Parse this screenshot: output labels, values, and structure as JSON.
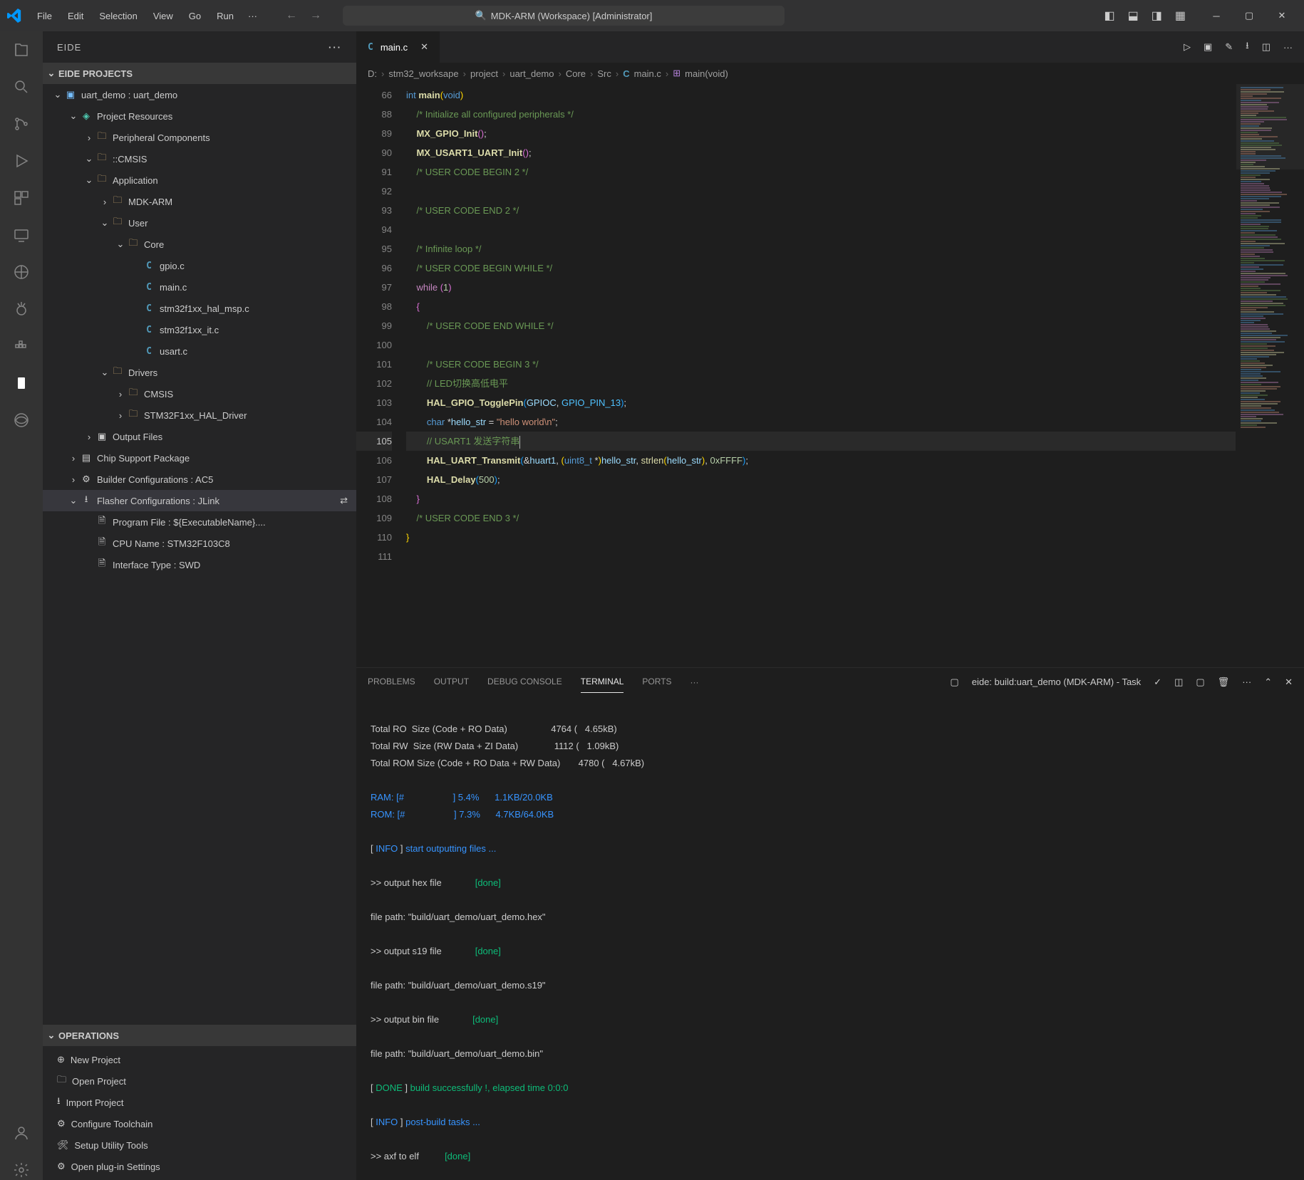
{
  "titlebar": {
    "menus": [
      "File",
      "Edit",
      "Selection",
      "View",
      "Go",
      "Run"
    ],
    "search_text": "MDK-ARM (Workspace) [Administrator]"
  },
  "sidebar": {
    "title": "EIDE",
    "section1": "EIDE PROJECTS",
    "tree": [
      {
        "depth": 0,
        "chev": "v",
        "icon": "proj",
        "label": "uart_demo : uart_demo"
      },
      {
        "depth": 1,
        "chev": "v",
        "icon": "res",
        "label": "Project Resources"
      },
      {
        "depth": 2,
        "chev": ">",
        "icon": "folder",
        "label": "Peripheral Components"
      },
      {
        "depth": 2,
        "chev": "v",
        "icon": "folder",
        "label": "::CMSIS"
      },
      {
        "depth": 2,
        "chev": "v",
        "icon": "folder",
        "label": "Application"
      },
      {
        "depth": 3,
        "chev": ">",
        "icon": "folder",
        "label": "MDK-ARM"
      },
      {
        "depth": 3,
        "chev": "v",
        "icon": "folder",
        "label": "User"
      },
      {
        "depth": 4,
        "chev": "v",
        "icon": "folder",
        "label": "Core"
      },
      {
        "depth": 5,
        "chev": "",
        "icon": "c",
        "label": "gpio.c"
      },
      {
        "depth": 5,
        "chev": "",
        "icon": "c",
        "label": "main.c"
      },
      {
        "depth": 5,
        "chev": "",
        "icon": "c",
        "label": "stm32f1xx_hal_msp.c"
      },
      {
        "depth": 5,
        "chev": "",
        "icon": "c",
        "label": "stm32f1xx_it.c"
      },
      {
        "depth": 5,
        "chev": "",
        "icon": "c",
        "label": "usart.c"
      },
      {
        "depth": 3,
        "chev": "v",
        "icon": "folder",
        "label": "Drivers"
      },
      {
        "depth": 4,
        "chev": ">",
        "icon": "folder",
        "label": "CMSIS"
      },
      {
        "depth": 4,
        "chev": ">",
        "icon": "folder",
        "label": "STM32F1xx_HAL_Driver"
      },
      {
        "depth": 2,
        "chev": ">",
        "icon": "out",
        "label": "Output Files"
      },
      {
        "depth": 1,
        "chev": ">",
        "icon": "chip",
        "label": "Chip Support Package"
      },
      {
        "depth": 1,
        "chev": ">",
        "icon": "build",
        "label": "Builder Configurations : AC5"
      },
      {
        "depth": 1,
        "chev": "v",
        "icon": "flash",
        "label": "Flasher Configurations : JLink",
        "selected": true,
        "trail": true
      },
      {
        "depth": 2,
        "chev": "",
        "icon": "file",
        "label": "Program File : ${ExecutableName}...."
      },
      {
        "depth": 2,
        "chev": "",
        "icon": "file",
        "label": "CPU Name : STM32F103C8"
      },
      {
        "depth": 2,
        "chev": "",
        "icon": "file",
        "label": "Interface Type : SWD"
      }
    ],
    "section2": "OPERATIONS",
    "ops": [
      {
        "icon": "new",
        "label": "New Project"
      },
      {
        "icon": "open",
        "label": "Open Project"
      },
      {
        "icon": "import",
        "label": "Import Project"
      },
      {
        "icon": "conf",
        "label": "Configure Toolchain"
      },
      {
        "icon": "setup",
        "label": "Setup Utility Tools"
      },
      {
        "icon": "plugin",
        "label": "Open plug-in Settings"
      }
    ]
  },
  "tab": {
    "filename": "main.c"
  },
  "breadcrumb": [
    "D:",
    "stm32_worksape",
    "project",
    "uart_demo",
    "Core",
    "Src"
  ],
  "breadcrumb_file": "main.c",
  "breadcrumb_fn": "main(void)",
  "code_lines": [
    {
      "n": 66,
      "html": "<span class='ty'>int</span> <span class='fn'>main</span><span class='br'>(</span><span class='ty'>void</span><span class='br'>)</span>"
    },
    {
      "n": 88,
      "html": "    <span class='cm'>/* Initialize all configured peripherals */</span>"
    },
    {
      "n": 89,
      "html": "    <span class='fn'>MX_GPIO_Init</span><span class='br2'>(</span><span class='br2'>)</span><span class='pn'>;</span>"
    },
    {
      "n": 90,
      "html": "    <span class='fn'>MX_USART1_UART_Init</span><span class='br2'>(</span><span class='br2'>)</span><span class='pn'>;</span>"
    },
    {
      "n": 91,
      "html": "    <span class='cm'>/* USER CODE BEGIN 2 */</span>"
    },
    {
      "n": 92,
      "html": ""
    },
    {
      "n": 93,
      "html": "    <span class='cm'>/* USER CODE END 2 */</span>"
    },
    {
      "n": 94,
      "html": ""
    },
    {
      "n": 95,
      "html": "    <span class='cm'>/* Infinite loop */</span>"
    },
    {
      "n": 96,
      "html": "    <span class='cm'>/* USER CODE BEGIN WHILE */</span>"
    },
    {
      "n": 97,
      "html": "    <span class='kw'>while</span> <span class='br2'>(</span><span class='num'>1</span><span class='br2'>)</span>"
    },
    {
      "n": 98,
      "html": "    <span class='br2'>{</span>"
    },
    {
      "n": 99,
      "html": "        <span class='cm'>/* USER CODE END WHILE */</span>"
    },
    {
      "n": 100,
      "html": ""
    },
    {
      "n": 101,
      "html": "        <span class='cm'>/* USER CODE BEGIN 3 */</span>"
    },
    {
      "n": 102,
      "html": "        <span class='cm'>// LED切换高低电平</span>"
    },
    {
      "n": 103,
      "html": "        <span class='fn'>HAL_GPIO_TogglePin</span><span class='br3'>(</span><span class='id'>GPIOC</span><span class='pn'>,</span> <span class='cons'>GPIO_PIN_13</span><span class='br3'>)</span><span class='pn'>;</span>"
    },
    {
      "n": 104,
      "html": "        <span class='ty'>char</span> <span class='op'>*</span><span class='id'>hello_str</span> <span class='op'>=</span> <span class='str'>\"hello world\\n\"</span><span class='pn'>;</span>"
    },
    {
      "n": 105,
      "hl": true,
      "html": "        <span class='cm'>// USART1 发送字符串</span><span class='cursor-bar'></span>"
    },
    {
      "n": 106,
      "html": "        <span class='fn'>HAL_UART_Transmit</span><span class='br3'>(</span><span class='op'>&</span><span class='id'>huart1</span><span class='pn'>,</span> <span class='br'>(</span><span class='ty'>uint8_t</span> <span class='op'>*</span><span class='br'>)</span><span class='id'>hello_str</span><span class='pn'>,</span> <span class='fn2'>strlen</span><span class='br'>(</span><span class='id'>hello_str</span><span class='br'>)</span><span class='pn'>,</span> <span class='num'>0xFFFF</span><span class='br3'>)</span><span class='pn'>;</span>"
    },
    {
      "n": 107,
      "html": "        <span class='fn'>HAL_Delay</span><span class='br3'>(</span><span class='num'>500</span><span class='br3'>)</span><span class='pn'>;</span>"
    },
    {
      "n": 108,
      "html": "    <span class='br2'>}</span>"
    },
    {
      "n": 109,
      "html": "    <span class='cm'>/* USER CODE END 3 */</span>"
    },
    {
      "n": 110,
      "html": "<span class='br'>}</span>"
    },
    {
      "n": 111,
      "html": ""
    }
  ],
  "panel": {
    "tabs": [
      "PROBLEMS",
      "OUTPUT",
      "DEBUG CONSOLE",
      "TERMINAL",
      "PORTS"
    ],
    "active_tab": "TERMINAL",
    "task": "eide: build:uart_demo (MDK-ARM) - Task",
    "lines": [
      {
        "t": "",
        "cls": ""
      },
      {
        "t": "Total RO  Size (Code + RO Data)                 4764 (   4.65kB)",
        "cls": "t-grey"
      },
      {
        "t": "Total RW  Size (RW Data + ZI Data)              1112 (   1.09kB)",
        "cls": "t-grey"
      },
      {
        "t": "Total ROM Size (Code + RO Data + RW Data)       4780 (   4.67kB)",
        "cls": "t-grey"
      },
      {
        "t": "",
        "cls": ""
      },
      {
        "t": "RAM: [#                   ] 5.4%      1.1KB/20.0KB",
        "cls": "t-cyan"
      },
      {
        "t": "ROM: [#                   ] 7.3%      4.7KB/64.0KB",
        "cls": "t-cyan"
      },
      {
        "t": "",
        "cls": ""
      },
      {
        "html": "<span class='t-grey'>[ </span><span class='t-cyan'>INFO</span><span class='t-grey'> ] </span><span class='t-cyan'>start outputting files ...</span>"
      },
      {
        "t": "",
        "cls": ""
      },
      {
        "html": "<span class='t-grey'>>> output hex file             </span><span class='t-green'>[done]</span>"
      },
      {
        "t": "",
        "cls": ""
      },
      {
        "t": "file path: \"build/uart_demo/uart_demo.hex\"",
        "cls": "t-grey"
      },
      {
        "t": "",
        "cls": ""
      },
      {
        "html": "<span class='t-grey'>>> output s19 file             </span><span class='t-green'>[done]</span>"
      },
      {
        "t": "",
        "cls": ""
      },
      {
        "t": "file path: \"build/uart_demo/uart_demo.s19\"",
        "cls": "t-grey"
      },
      {
        "t": "",
        "cls": ""
      },
      {
        "html": "<span class='t-grey'>>> output bin file             </span><span class='t-green'>[done]</span>"
      },
      {
        "t": "",
        "cls": ""
      },
      {
        "t": "file path: \"build/uart_demo/uart_demo.bin\"",
        "cls": "t-grey"
      },
      {
        "t": "",
        "cls": ""
      },
      {
        "html": "<span class='t-grey'>[ </span><span class='t-green'>DONE</span><span class='t-grey'> ] </span><span class='t-green'>build successfully !, elapsed time 0:0:0</span>"
      },
      {
        "t": "",
        "cls": ""
      },
      {
        "html": "<span class='t-grey'>[ </span><span class='t-cyan'>INFO</span><span class='t-grey'> ] </span><span class='t-cyan'>post-build tasks ...</span>"
      },
      {
        "t": "",
        "cls": ""
      },
      {
        "html": "<span class='t-grey'>>> axf to elf          </span><span class='t-green'>[done]</span>"
      }
    ]
  }
}
